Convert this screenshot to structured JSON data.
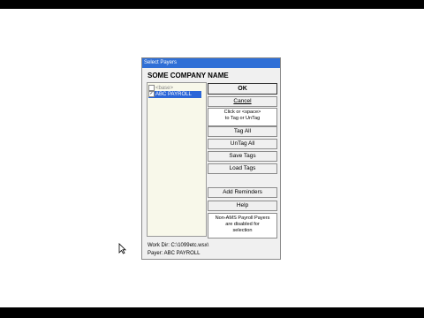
{
  "dialog": {
    "title": "Select Payers",
    "company_name": "SOME COMPANY NAME"
  },
  "payer_list": [
    {
      "label": "<base>",
      "checked": false
    },
    {
      "label": "ABC PAYROLL",
      "checked": true
    }
  ],
  "buttons": {
    "ok": "OK",
    "cancel": "Cancel",
    "tag_all": "Tag All",
    "untag_all": "UnTag All",
    "save_tags": "Save Tags",
    "load_tags": "Load Tags",
    "add_reminders": "Add Reminders",
    "help": "Help"
  },
  "info": {
    "tag_hint": "Click or <space>\nto Tag or UnTag",
    "non_ams_note": "Non-AMS Payroll Payers\nare disabled for\nselection"
  },
  "status": {
    "work_dir": "Work Dir: C:\\1099etc.wsx\\",
    "payer": "Payer: ABC PAYROLL"
  },
  "colors": {
    "titlebar": "#2f6fd6",
    "selection": "#2b66d8",
    "list_bg": "#f8f8ea"
  }
}
